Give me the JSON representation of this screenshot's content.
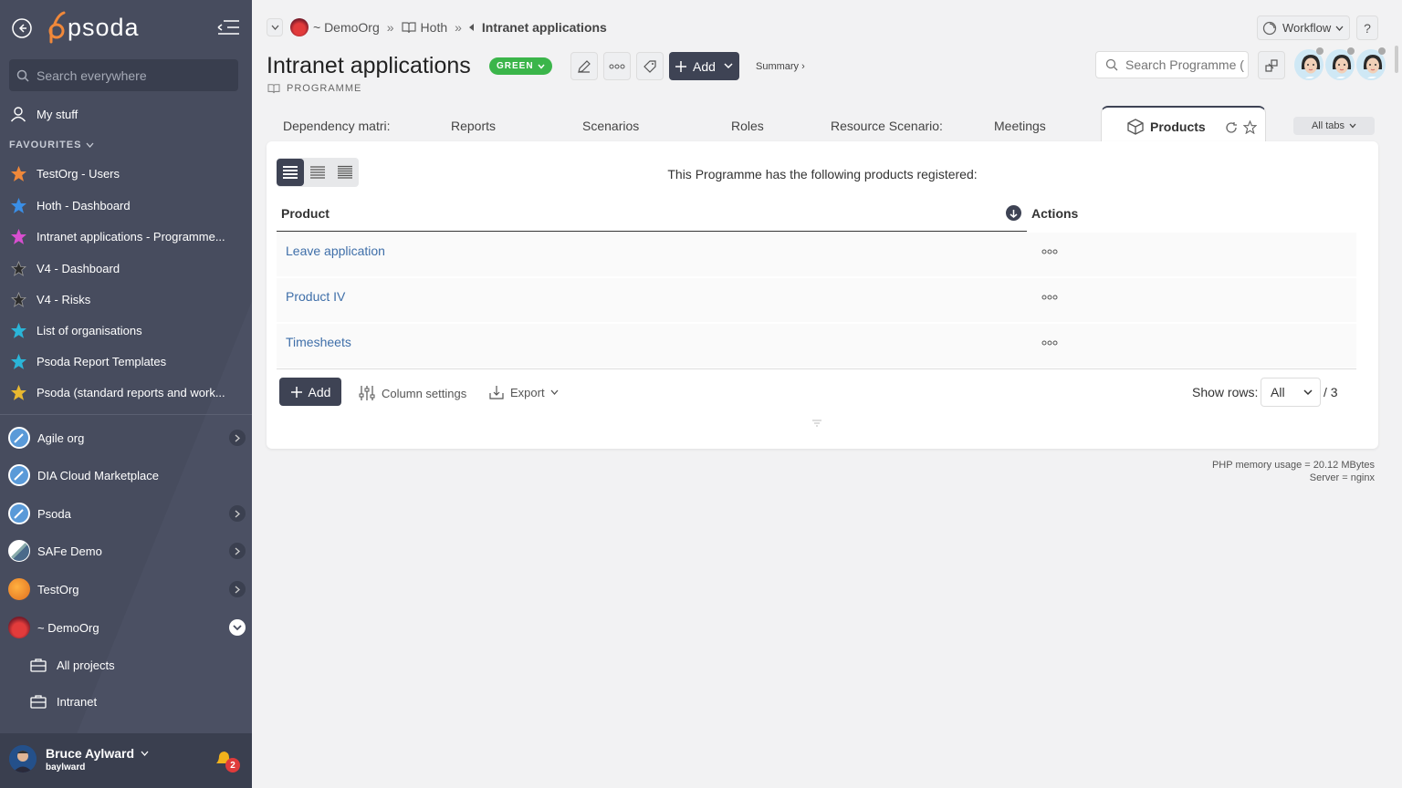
{
  "sidebar": {
    "search_placeholder": "Search everywhere",
    "my_stuff": "My stuff",
    "favourites_heading": "FAVOURITES",
    "favourites": [
      {
        "label": "TestOrg - Users",
        "color": "#f0883a"
      },
      {
        "label": "Hoth - Dashboard",
        "color": "#3a8ee6"
      },
      {
        "label": "Intranet applications - Programme...",
        "color": "#d84fd0"
      },
      {
        "label": "V4 - Dashboard",
        "color": "#2b2b2b"
      },
      {
        "label": "V4 - Risks",
        "color": "#2b2b2b"
      },
      {
        "label": "List of organisations",
        "color": "#2bb5d8"
      },
      {
        "label": "Psoda Report Templates",
        "color": "#2bb5d8"
      },
      {
        "label": "Psoda (standard reports and work...",
        "color": "#e8b830"
      }
    ],
    "orgs": [
      {
        "label": "Agile org",
        "has_chevron": true
      },
      {
        "label": "DIA Cloud Marketplace",
        "has_chevron": false
      },
      {
        "label": "Psoda",
        "has_chevron": true
      },
      {
        "label": "SAFe Demo",
        "has_chevron": true
      },
      {
        "label": "TestOrg",
        "has_chevron": true
      },
      {
        "label": "~ DemoOrg",
        "has_chevron": true
      }
    ],
    "sub_items": [
      "All projects",
      "Intranet"
    ],
    "user": {
      "name": "Bruce Aylward",
      "username": "baylward",
      "notifications": "2"
    }
  },
  "breadcrumb": {
    "org": "~ DemoOrg",
    "portfolio": "Hoth",
    "current": "Intranet applications"
  },
  "header": {
    "workflow": "Workflow",
    "help": "?",
    "title": "Intranet applications",
    "status": "GREEN",
    "type": "PROGRAMME",
    "add_label": "Add",
    "summary": "Summary ›",
    "search_placeholder": "Search Programme (",
    "status_color": "#3bb54a"
  },
  "tabs": [
    "Dependency matri:",
    "Reports",
    "Scenarios",
    "Roles",
    "Resource Scenario:",
    "Meetings"
  ],
  "active_tab": "Products",
  "all_tabs": "All tabs",
  "products": {
    "intro": "This Programme has the following products registered:",
    "columns": {
      "product": "Product",
      "actions": "Actions"
    },
    "rows": [
      "Leave application",
      "Product IV",
      "Timesheets"
    ],
    "add_label": "Add",
    "column_settings": "Column settings",
    "export": "Export",
    "show_rows_label": "Show rows:",
    "show_rows_value": "All",
    "total": "/ 3"
  },
  "footer": {
    "memory": "PHP memory usage = 20.12 MBytes",
    "server": "Server = nginx"
  }
}
